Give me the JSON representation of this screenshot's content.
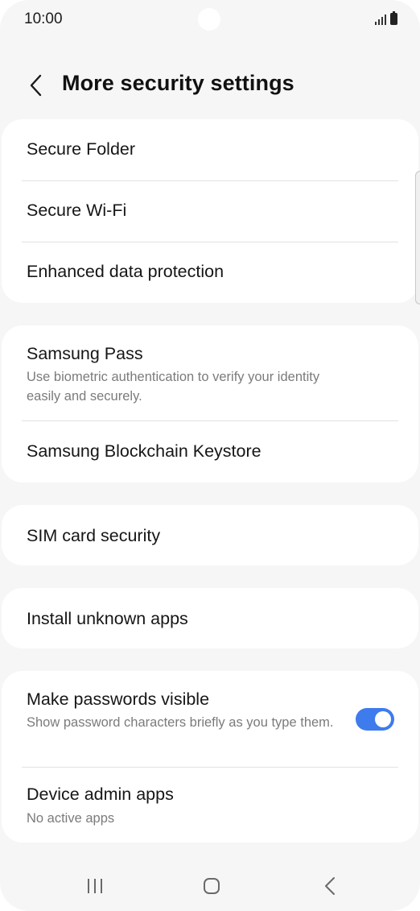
{
  "status_bar": {
    "time": "10:00"
  },
  "header": {
    "title": "More security settings",
    "back_icon": "chevron-left-icon"
  },
  "groups": [
    {
      "items": [
        {
          "title": "Secure Folder"
        },
        {
          "title": "Secure Wi-Fi"
        },
        {
          "title": "Enhanced data protection"
        }
      ]
    },
    {
      "items": [
        {
          "title": "Samsung Pass",
          "subtitle": "Use biometric authentication to verify your identity easily and securely."
        },
        {
          "title": "Samsung Blockchain Keystore"
        }
      ]
    },
    {
      "items": [
        {
          "title": "SIM card security"
        }
      ]
    },
    {
      "items": [
        {
          "title": "Install unknown apps"
        }
      ]
    },
    {
      "items": [
        {
          "title": "Make passwords visible",
          "subtitle": "Show password characters briefly as you type them.",
          "toggle_on": true
        },
        {
          "title": "Device admin apps",
          "subtitle": "No active apps"
        }
      ]
    }
  ],
  "colors": {
    "accent": "#3e7bed",
    "background": "#f6f6f6",
    "card": "#ffffff",
    "subtitle": "#7b7b7b"
  },
  "navbar": {
    "recents_icon": "recents-icon",
    "home_icon": "home-icon",
    "back_icon": "back-icon"
  }
}
